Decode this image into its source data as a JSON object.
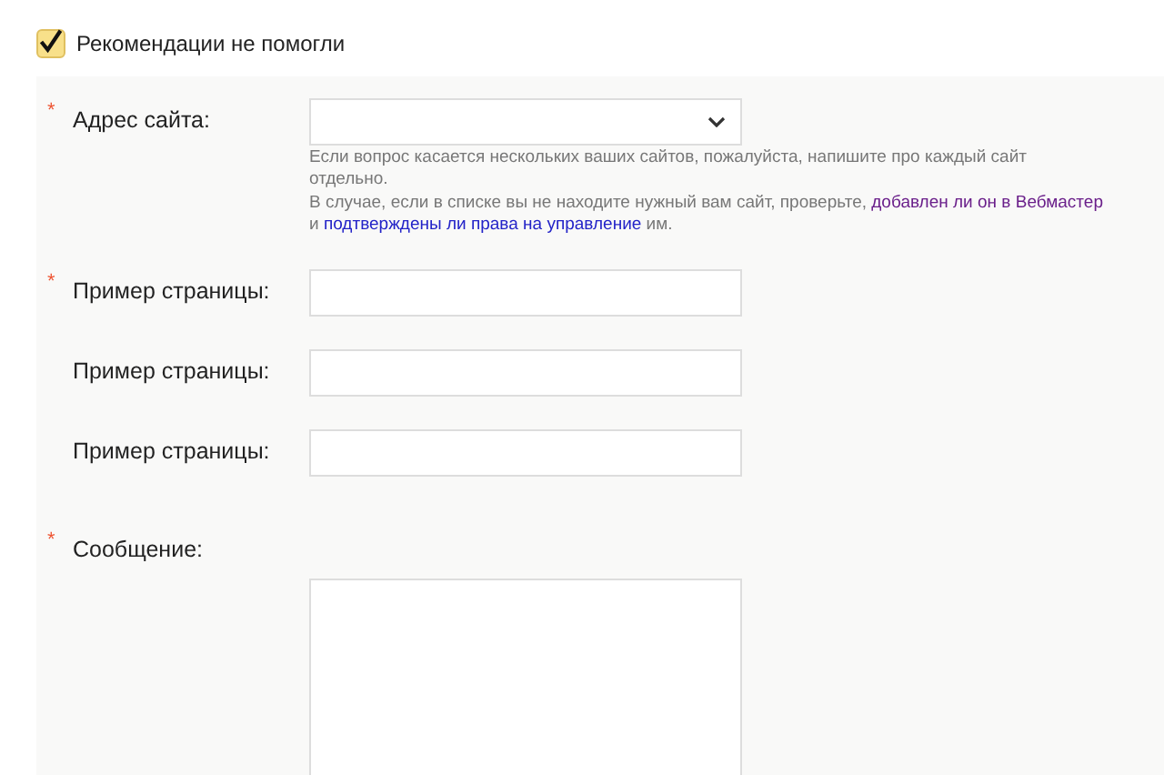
{
  "checkbox": {
    "label": "Рекомендации не помогли",
    "checked": true
  },
  "site_field": {
    "required_mark": "*",
    "label": "Адрес сайта:",
    "hint_1": "Если вопрос касается нескольких ваших сайтов, пожалуйста, напишите про каждый сайт отдельно.",
    "hint_2": [
      {
        "kind": "text",
        "text": "В случае, если в списке вы не находите нужный вам сайт, проверьте, "
      },
      {
        "kind": "link",
        "text": "добавлен ли он в Вебмастер",
        "visited": true
      },
      {
        "kind": "text",
        "text": " и "
      },
      {
        "kind": "link",
        "text": "подтверждены ли права на управление",
        "visited": false
      },
      {
        "kind": "text",
        "text": " им."
      }
    ]
  },
  "page_fields": [
    {
      "required_mark": "*",
      "label": "Пример страницы:"
    },
    {
      "label": "Пример страницы:"
    },
    {
      "label": "Пример страницы:"
    }
  ],
  "message": {
    "required_mark": "*",
    "label": "Сообщение:"
  }
}
